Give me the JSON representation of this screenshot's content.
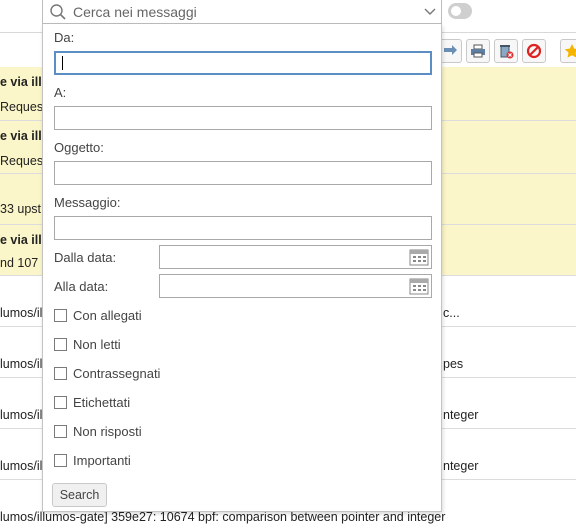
{
  "search": {
    "placeholder": "Cerca nei messaggi"
  },
  "form": {
    "from_label": "Da:",
    "to_label": "A:",
    "subject_label": "Oggetto:",
    "message_label": "Messaggio:",
    "date_from_label": "Dalla data:",
    "date_to_label": "Alla data:",
    "checkboxes": [
      "Con allegati",
      "Non letti",
      "Contrassegnati",
      "Etichettati",
      "Non risposti",
      "Importanti"
    ],
    "search_button": "Search"
  },
  "messages": [
    {
      "line1": "e via illu",
      "line2": "Reques",
      "unread": true
    },
    {
      "line1": "e via illu",
      "line2": "Reques",
      "unread": true
    },
    {
      "line1": "33 upst",
      "line2": "",
      "unread": true
    },
    {
      "line1": "e via illu",
      "line2": "nd 107",
      "unread": true
    },
    {
      "line1": "lumos/il",
      "right": "c...",
      "unread": false
    },
    {
      "line1": "lumos/il",
      "right": "pes",
      "unread": false
    },
    {
      "line1": "lumos/il",
      "right": "nteger",
      "unread": false
    },
    {
      "line1": "lumos/il",
      "right": "nteger",
      "unread": false
    },
    {
      "line1": "lumos/illumos-gate] 359e27: 10674 bpf: comparison between pointer and integer",
      "unread": false
    }
  ],
  "colors": {
    "unread_bg": "#fbf6c9",
    "focus_border": "#5b8fc4"
  }
}
